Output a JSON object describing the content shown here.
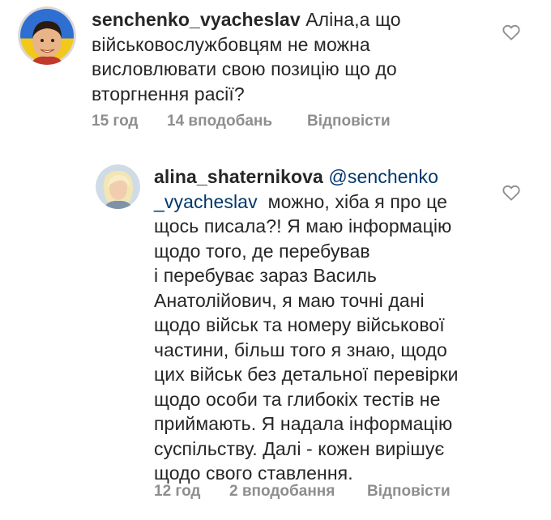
{
  "comments": [
    {
      "username": "senchenko_vyacheslav",
      "text_lines": [
        "Аліна,а що",
        "військовослужбовцям не можна",
        "висловлювати свою позицію що до",
        "вторгнення расії?"
      ],
      "time": "15 год",
      "likes": "14 вподобань",
      "reply": "Відповісти",
      "avatar_icon": "user-avatar-icon",
      "like_icon": "heart-outline-icon"
    },
    {
      "username": "alina_shaternikova",
      "mention_part1": "@senchenko",
      "mention_part2": "_vyacheslav",
      "text_after_mention": "можно, хіба я про це",
      "text_lines": [
        "щось писала?! Я маю інформацію",
        "щодо того, де перебував",
        "і перебуває зараз Василь",
        "Анатолійович, я маю точні дані",
        "щодо військ та номеру військової",
        "частини, більш того я знаю, щодо",
        "цих військ без детальної перевірки",
        "щодо особи та глибокіх тестів не",
        "приймають. Я надала інформацію",
        "суспільству. Далі - кожен вирішує",
        "щодо свого ставлення."
      ],
      "time": "12 год",
      "likes": "2 вподобання",
      "reply": "Відповісти",
      "avatar_icon": "user-avatar-icon",
      "like_icon": "heart-outline-icon"
    }
  ]
}
